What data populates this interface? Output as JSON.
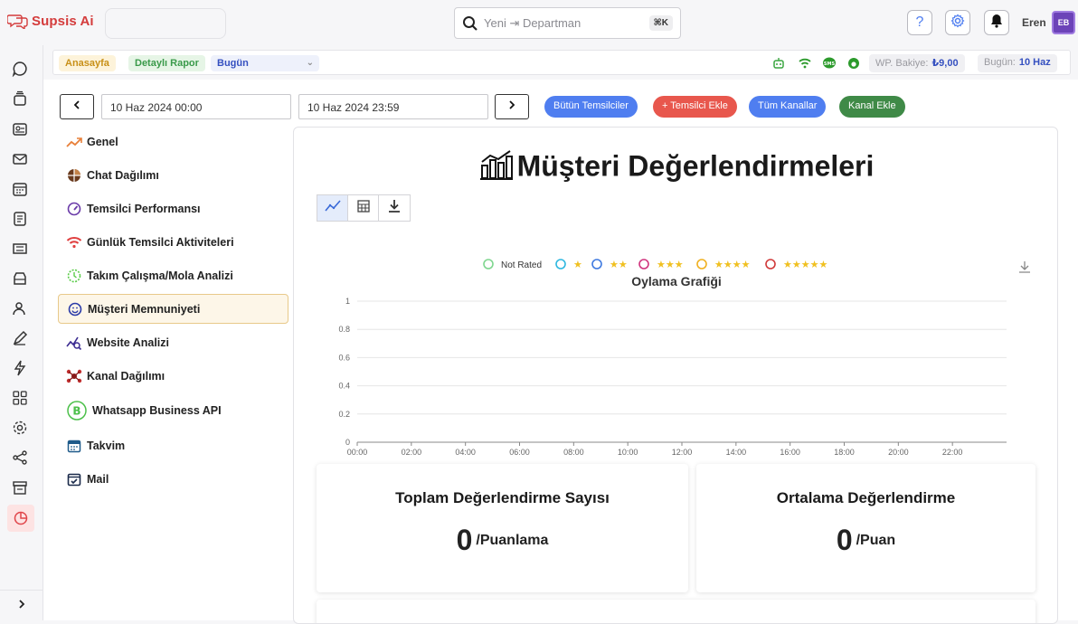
{
  "app": {
    "name": "Supsis Ai"
  },
  "search": {
    "placeholder": "Yeni ⇥ Departman",
    "shortcut": "⌘K"
  },
  "user": {
    "name": "Eren",
    "avatar_text": "EB"
  },
  "subbar": {
    "breadcrumbs": [
      "Anasayfa",
      "Detaylı Rapor"
    ],
    "range_select": "Bugün",
    "wp_balance_label": "WP. Bakiye:",
    "wp_balance_value": "₺9,00",
    "today_label": "Bugün:",
    "today_value": "10 Haz"
  },
  "filters": {
    "start_date": "10 Haz 2024 00:00",
    "end_date": "10 Haz 2024 23:59",
    "buttons": [
      {
        "label": "Bütün Temsilciler",
        "color": "#4f7ef0"
      },
      {
        "label": "+ Temsilci Ekle",
        "color": "#e8574d"
      },
      {
        "label": "Tüm Kanallar",
        "color": "#4f7ef0"
      },
      {
        "label": "Kanal Ekle",
        "color": "#3f8a47"
      }
    ]
  },
  "menu": {
    "items": [
      {
        "label": "Genel",
        "icon": "trend-icon"
      },
      {
        "label": "Chat Dağılımı",
        "icon": "pie-icon"
      },
      {
        "label": "Temsilci Performansı",
        "icon": "gauge-icon"
      },
      {
        "label": "Günlük Temsilci Aktiviteleri",
        "icon": "wifi-icon"
      },
      {
        "label": "Takım Çalışma/Mola Analizi",
        "icon": "clock-icon"
      },
      {
        "label": "Müşteri Memnuniyeti",
        "icon": "smile-icon"
      },
      {
        "label": "Website Analizi",
        "icon": "analytics-icon"
      },
      {
        "label": "Kanal Dağılımı",
        "icon": "network-icon"
      },
      {
        "label": "Whatsapp Business API",
        "icon": "whatsapp-icon"
      },
      {
        "label": "Takvim",
        "icon": "calendar-icon"
      },
      {
        "label": "Mail",
        "icon": "mail-check-icon"
      }
    ],
    "active_index": 5
  },
  "main": {
    "title": "Müşteri Değerlendirmeleri",
    "total": {
      "title": "Toplam Değerlendirme Sayısı",
      "value": "0",
      "unit": "/Puanlama"
    },
    "average": {
      "title": "Ortalama Değerlendirme",
      "value": "0",
      "unit": "/Puan"
    }
  },
  "chart_data": {
    "type": "line",
    "title": "Oylama Grafiği",
    "x": [
      "00:00",
      "02:00",
      "04:00",
      "06:00",
      "08:00",
      "10:00",
      "12:00",
      "14:00",
      "16:00",
      "18:00",
      "20:00",
      "22:00"
    ],
    "ylim": [
      0,
      1
    ],
    "yticks": [
      "0",
      "0.2",
      "0.4",
      "0.6",
      "0.8",
      "1"
    ],
    "grid": true,
    "legend_position": "top",
    "series": [
      {
        "name": "Not Rated",
        "color": "#7fd68f",
        "values": []
      },
      {
        "name": "★",
        "color": "#2fb8e0",
        "values": []
      },
      {
        "name": "★★",
        "color": "#3f7ae0",
        "values": []
      },
      {
        "name": "★★★",
        "color": "#d0357e",
        "values": []
      },
      {
        "name": "★★★★",
        "color": "#f0b020",
        "values": []
      },
      {
        "name": "★★★★★",
        "color": "#d03a3a",
        "values": []
      }
    ],
    "star_color": "#f0c020"
  }
}
